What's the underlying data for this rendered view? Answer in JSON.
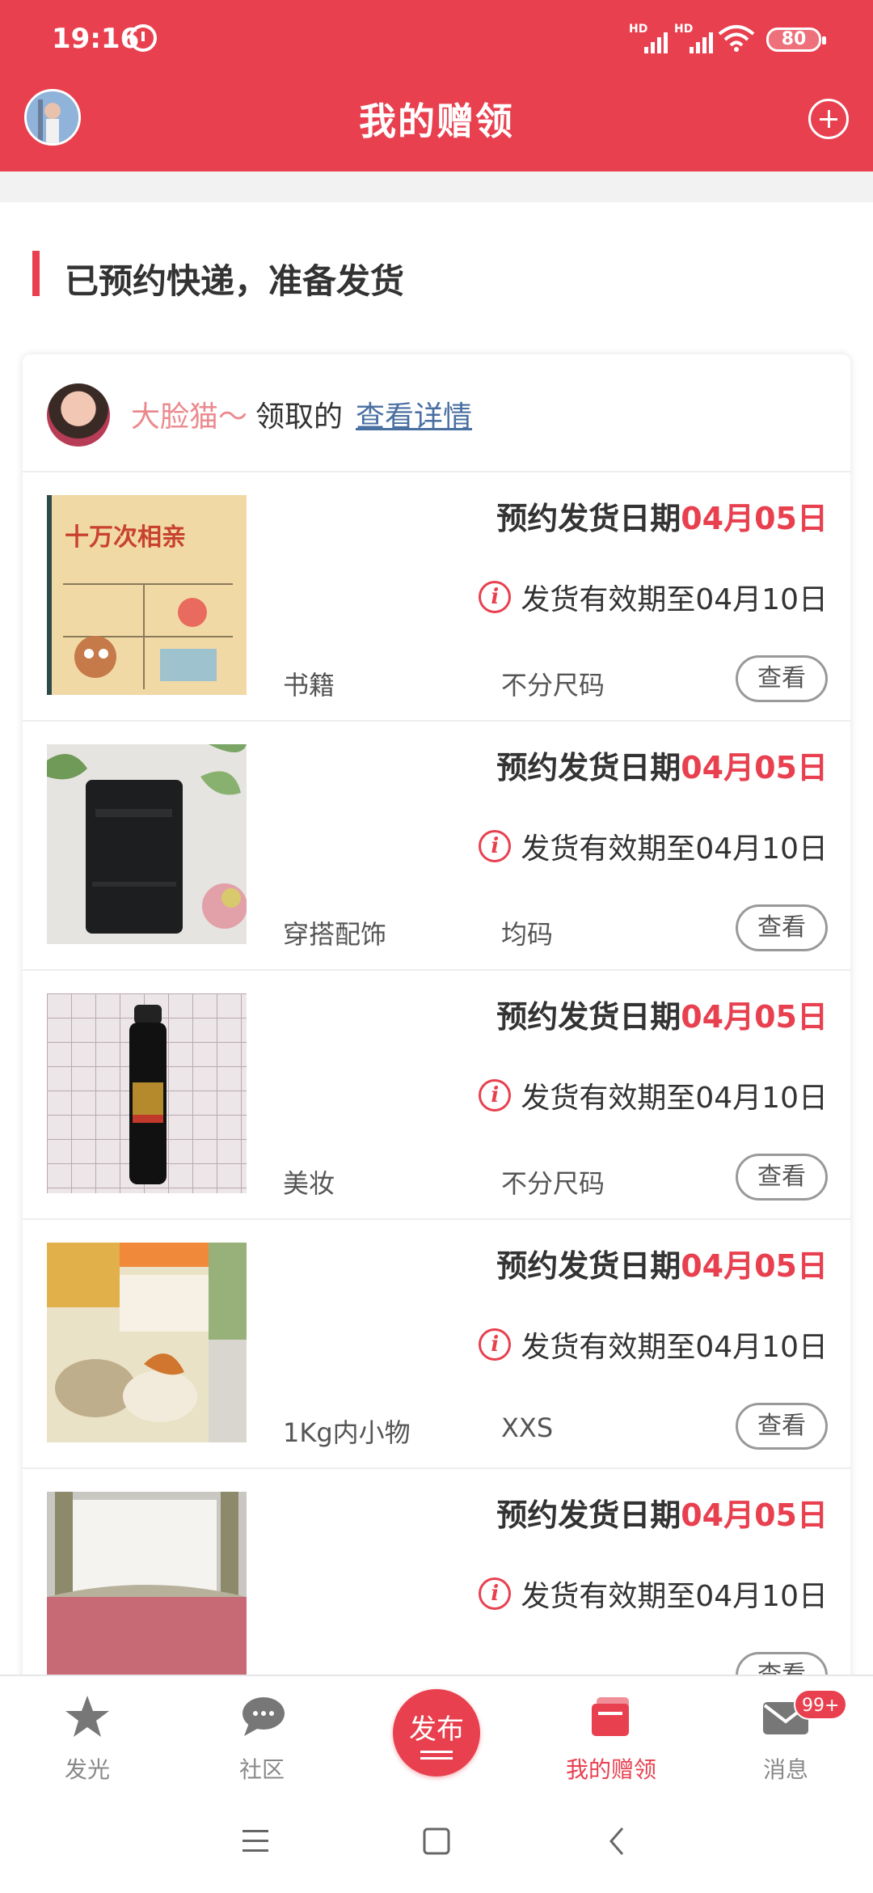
{
  "status": {
    "time": "19:16",
    "hd": "HD",
    "battery": "80"
  },
  "header": {
    "title": "我的赠领"
  },
  "section": {
    "title": "已预约快递，准备发货"
  },
  "card": {
    "giver_name": "大脸猫～",
    "picked_text": "领取的",
    "detail_link": "查看详情",
    "items": [
      {
        "date_label": "预约发货日期",
        "date_value": "04月05日",
        "valid_text": "发货有效期至04月10日",
        "category": "书籍",
        "size": "不分尺码",
        "view_label": "查看"
      },
      {
        "date_label": "预约发货日期",
        "date_value": "04月05日",
        "valid_text": "发货有效期至04月10日",
        "category": "穿搭配饰",
        "size": "均码",
        "view_label": "查看"
      },
      {
        "date_label": "预约发货日期",
        "date_value": "04月05日",
        "valid_text": "发货有效期至04月10日",
        "category": "美妆",
        "size": "不分尺码",
        "view_label": "查看"
      },
      {
        "date_label": "预约发货日期",
        "date_value": "04月05日",
        "valid_text": "发货有效期至04月10日",
        "category": "1Kg内小物",
        "size": "XXS",
        "view_label": "查看"
      },
      {
        "date_label": "预约发货日期",
        "date_value": "04月05日",
        "valid_text": "发货有效期至04月10日",
        "category": "",
        "size": "",
        "view_label": "查看"
      }
    ],
    "book_cover_title": "十万次相亲"
  },
  "tabbar": {
    "tabs": [
      {
        "label": "发光",
        "icon": "star-icon"
      },
      {
        "label": "社区",
        "icon": "chat-bubble-icon"
      },
      {
        "label": "发布",
        "icon": "publish-icon"
      },
      {
        "label": "我的赠领",
        "icon": "gift-cards-icon"
      },
      {
        "label": "消息",
        "icon": "envelope-icon",
        "badge": "99+"
      }
    ]
  },
  "colors": {
    "accent": "#e8404f",
    "giver_name": "#eb8a8e",
    "link": "#4a6fa1"
  }
}
